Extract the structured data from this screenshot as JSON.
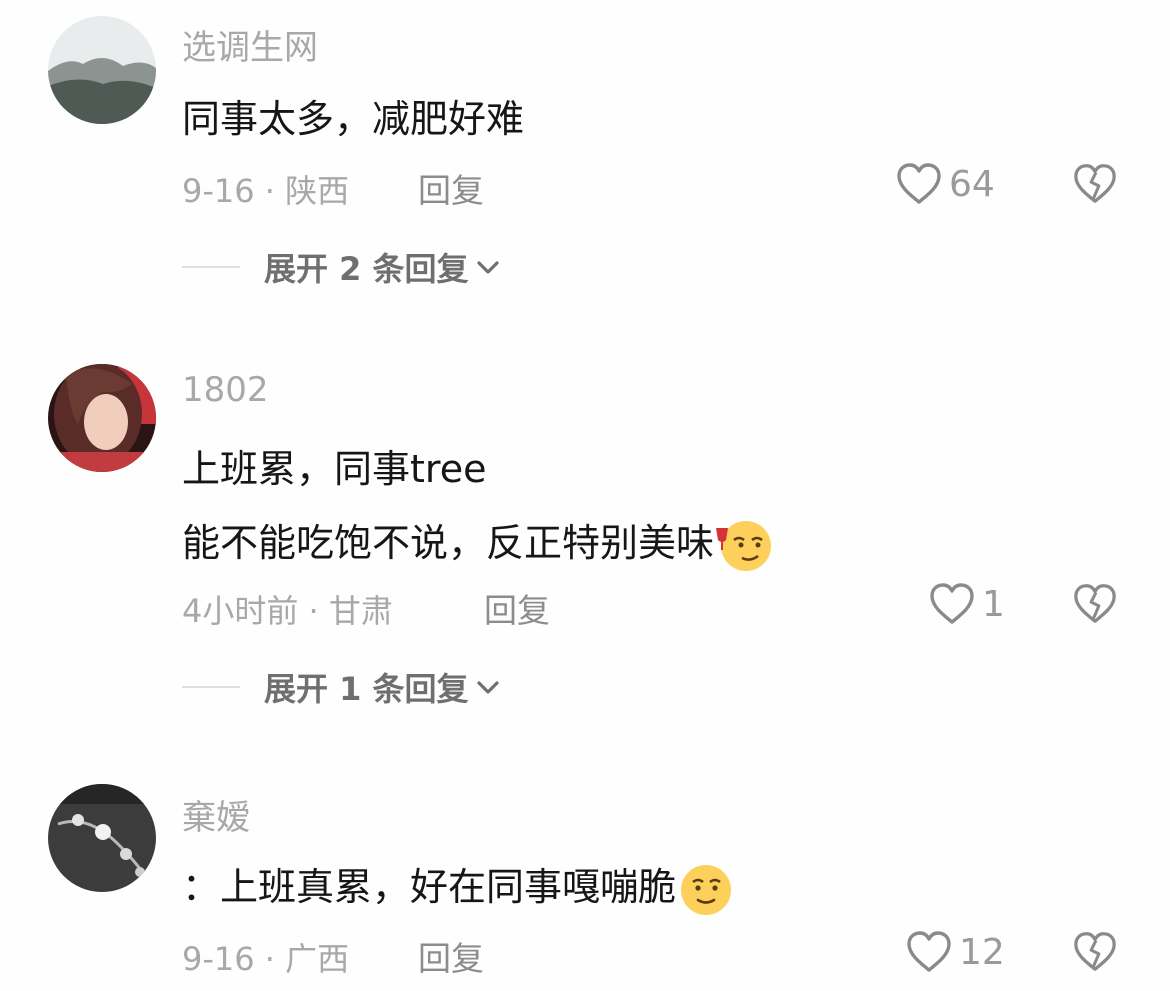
{
  "comments": [
    {
      "username": "选调生网",
      "lines": [
        "同事太多，减肥好难"
      ],
      "meta": "9-16 · 陕西",
      "reply_label": "回复",
      "like_count": "64",
      "expand_label": "展开 2 条回复"
    },
    {
      "username": "1802",
      "lines": [
        "上班累，同事tree",
        "能不能吃饱不说，反正特别美味"
      ],
      "meta": "4小时前 · 甘肃",
      "reply_label": "回复",
      "like_count": "1",
      "expand_label": "展开 1 条回复"
    },
    {
      "username": "棄嫒",
      "lines": [
        "：上班真累，好在同事嘎嘣脆"
      ],
      "meta": "9-16 · 广西",
      "reply_label": "回复",
      "like_count": "12"
    }
  ],
  "icons": {
    "like": "heart-outline-icon",
    "dislike": "broken-heart-icon",
    "expand": "chevron-down-icon"
  },
  "colors": {
    "text": "#161616",
    "secondary": "#a8a8a8",
    "emoji": "#fcd05a"
  }
}
